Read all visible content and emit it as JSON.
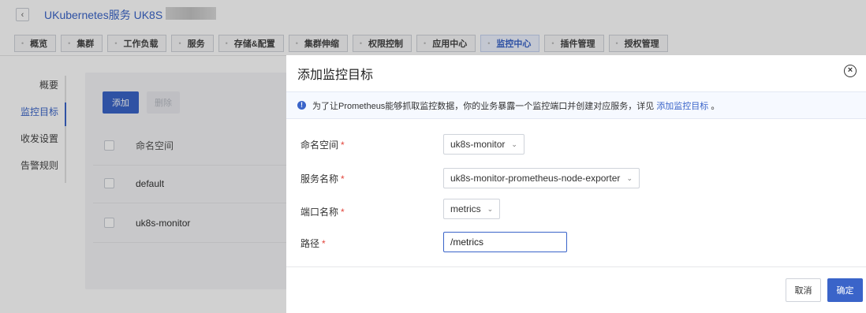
{
  "header": {
    "back_glyph": "‹",
    "breadcrumb": "UKubernetes服务 UK8S /"
  },
  "tabs": [
    {
      "label": "概览",
      "active": false
    },
    {
      "label": "集群",
      "active": false
    },
    {
      "label": "工作负载",
      "active": false
    },
    {
      "label": "服务",
      "active": false
    },
    {
      "label": "存储&配置",
      "active": false
    },
    {
      "label": "集群伸缩",
      "active": false
    },
    {
      "label": "权限控制",
      "active": false
    },
    {
      "label": "应用中心",
      "active": false
    },
    {
      "label": "监控中心",
      "active": true
    },
    {
      "label": "插件管理",
      "active": false
    },
    {
      "label": "授权管理",
      "active": false
    }
  ],
  "sidebar": {
    "items": [
      {
        "label": "概要",
        "active": false
      },
      {
        "label": "监控目标",
        "active": true
      },
      {
        "label": "收发设置",
        "active": false
      },
      {
        "label": "告警规则",
        "active": false
      }
    ]
  },
  "toolbar": {
    "add_label": "添加",
    "delete_label": "删除"
  },
  "table": {
    "header": "命名空间",
    "rows": [
      "default",
      "uk8s-monitor"
    ]
  },
  "modal": {
    "title": "添加监控目标",
    "notice_text": "为了让Prometheus能够抓取监控数据，你的业务暴露一个监控端口并创建对应服务，详见",
    "notice_link": "添加监控目标",
    "notice_tail": "。",
    "fields": {
      "namespace_label": "命名空间",
      "namespace_value": "uk8s-monitor",
      "service_label": "服务名称",
      "service_value": "uk8s-monitor-prometheus-node-exporter",
      "port_label": "端口名称",
      "port_value": "metrics",
      "path_label": "路径",
      "path_value": "/metrics"
    },
    "required_mark": "*",
    "cancel_label": "取消",
    "ok_label": "确定"
  },
  "colors": {
    "accent": "#3a64c9",
    "required": "#e2453b"
  }
}
